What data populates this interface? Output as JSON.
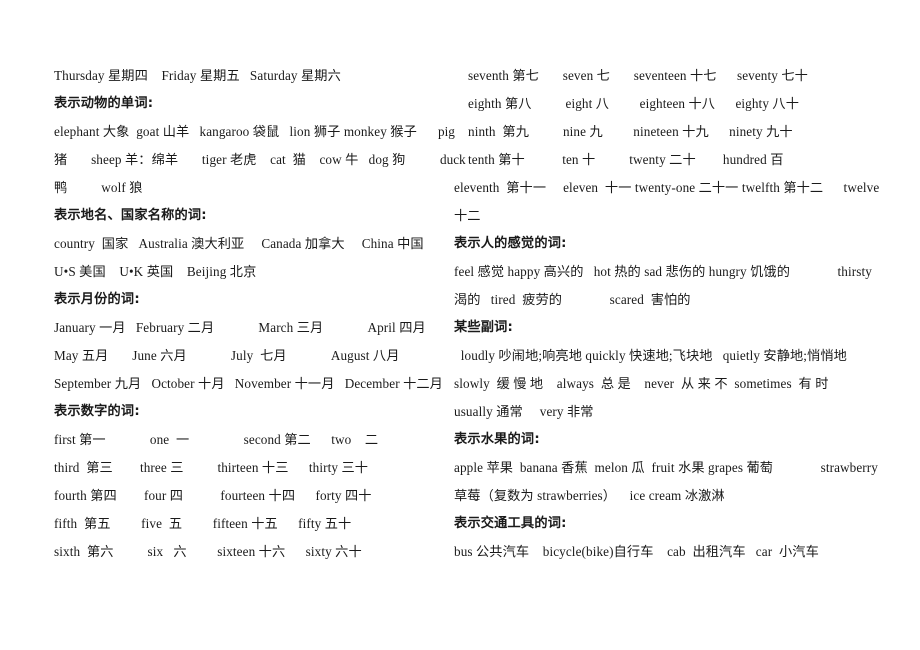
{
  "document": {
    "type": "vocabulary-study-sheet",
    "language_pair": "English-Chinese",
    "page_background": "#ffffff",
    "text_color": "#1a1a1a"
  },
  "left_column": {
    "weekdays_line": "Thursday 星期四    Friday 星期五   Saturday 星期六",
    "animals": {
      "heading": "表示动物的单词:",
      "lines": [
        "elephant 大象  goat 山羊   kangaroo 袋鼠   lion 狮子 monkey 猴子",
        "猪       sheep 羊：绵羊       tiger 老虎    cat  猫    cow 牛   dog 狗",
        "鸭          wolf 狼"
      ]
    },
    "places": {
      "heading": "表示地名、国家名称的词:",
      "lines": [
        "country  国家   Australia 澳大利亚     Canada 加拿大     China 中国",
        "U•S 美国    U•K 英国    Beijing 北京"
      ]
    },
    "months": {
      "heading": "表示月份的词:",
      "lines": [
        "January 一月   February 二月             March 三月             April 四月",
        "May 五月       June 六月             July  七月             August 八月",
        "September 九月   October 十月   November 十一月   December 十二月"
      ]
    },
    "numbers": {
      "heading": "表示数字的词:",
      "lines": [
        "first 第一             one  一                second 第二      two    二",
        "third  第三        three 三          thirteen 十三      thirty 三十",
        "fourth 第四        four 四           fourteen 十四      forty 四十",
        "fifth  第五         five  五         fifteen 十五      fifty 五十",
        "sixth  第六          six   六         sixteen 十六      sixty 六十"
      ]
    }
  },
  "right_column": {
    "numbers_continued": {
      "lines": [
        "seventh 第七       seven 七       seventeen 十七      seventy 七十",
        "eighth 第八          eight 八         eighteen 十八      eighty 八十",
        "ninth  第九          nine 九         nineteen 十九      ninety 九十",
        "tenth 第十           ten 十          twenty 二十        hundred 百",
        "eleventh  第十一     eleven  十一 twenty-one 二十一 twelfth 第十二      twelve",
        "十二"
      ]
    },
    "stray_overlap": {
      "pig": "pig",
      "duck": "duck",
      "note": "English words 'pig' and 'duck' overlap the start of the ninth/tenth lines"
    },
    "feelings": {
      "heading": "表示人的感觉的词:",
      "lines": [
        "feel 感觉 happy 高兴的   hot 热的 sad 悲伤的 hungry 饥饿的              thirsty",
        "渴的   tired  疲劳的              scared  害怕的"
      ]
    },
    "adverbs": {
      "heading": "某些副词:",
      "lines": [
        "  loudly 吵闹地;响亮地 quickly 快速地;飞块地   quietly 安静地;悄悄地",
        "slowly  缓 慢 地    always  总 是    never  从 来 不  sometimes  有 时",
        "usually 通常     very 非常"
      ]
    },
    "fruits": {
      "heading": "表示水果的词:",
      "lines": [
        "apple 苹果  banana 香蕉  melon 瓜  fruit 水果 grapes 葡萄              strawberry",
        "草莓（复数为 strawberries）    ice cream 冰激淋"
      ]
    },
    "transport": {
      "heading": "表示交通工具的词:",
      "lines": [
        "bus 公共汽车    bicycle(bike)自行车    cab  出租汽车   car  小汽车"
      ]
    }
  }
}
